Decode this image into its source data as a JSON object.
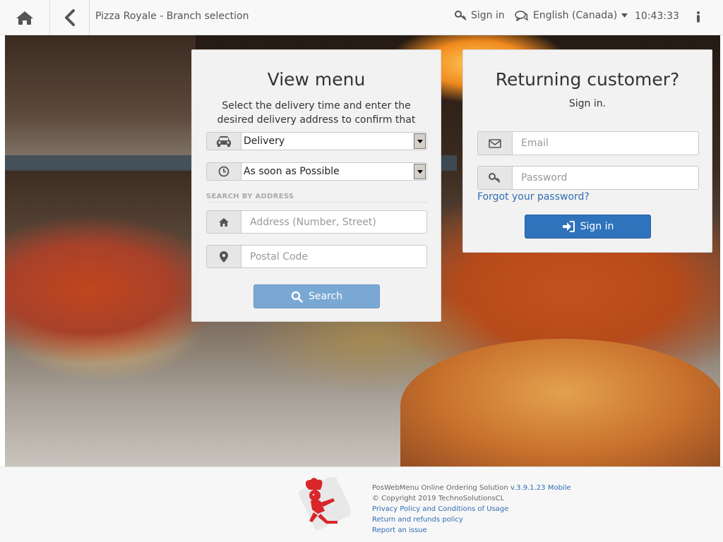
{
  "topbar": {
    "title": "Pizza Royale - Branch selection",
    "signin_label": "Sign in",
    "language_label": "English (Canada)",
    "time": "10:43:33",
    "icons": [
      "home-icon",
      "back-icon",
      "key-icon",
      "chat-icon",
      "caret-down-icon",
      "info-icon"
    ]
  },
  "menu_panel": {
    "title": "View menu",
    "description": "Select the delivery time and enter the desired delivery address to confirm that your area is covered by one of our branches.",
    "order_type_selected": "Delivery",
    "time_selected": "As soon as Possible",
    "section_label": "SEARCH BY ADDRESS",
    "address_placeholder": "Address (Number, Street)",
    "postal_placeholder": "Postal Code",
    "search_label": "Search"
  },
  "login_panel": {
    "title": "Returning customer?",
    "subtitle": "Sign in.",
    "email_placeholder": "Email",
    "password_placeholder": "Password",
    "forgot_label": "Forgot your password?",
    "signin_label": "Sign in"
  },
  "footer": {
    "product": "PosWebMenu Online Ordering Solution",
    "version": "v.3.9.1.23 Mobile",
    "copyright": "© Copyright 2019 TechnoSolutionsCL",
    "privacy": "Privacy Policy and Conditions of Usage",
    "refunds": "Return and refunds policy",
    "report": "Report an issue"
  },
  "colors": {
    "primary": "#2f73bd",
    "primary_disabled": "#7aa8d4",
    "link": "#2f6eb3",
    "topbar_bg": "#f8f8f8",
    "panel_bg": "#f2f2f2"
  }
}
